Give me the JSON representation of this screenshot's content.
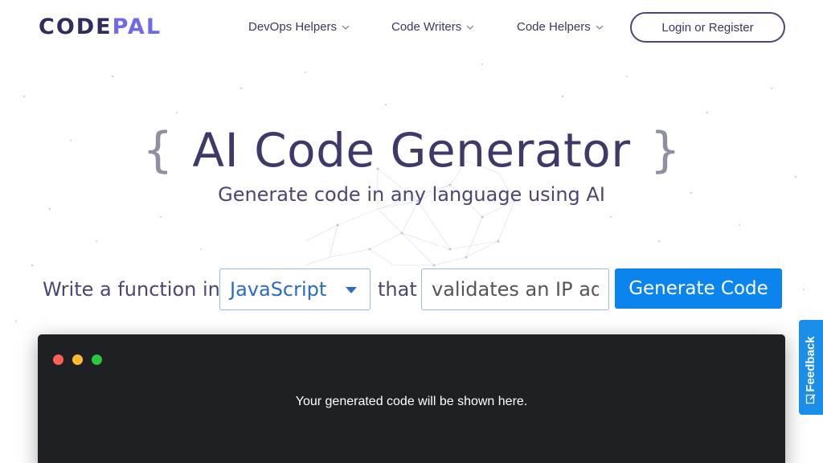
{
  "header": {
    "logo_primary": "CODE",
    "logo_accent": "PAL",
    "nav": [
      {
        "label": "DevOps Helpers"
      },
      {
        "label": "Code Writers"
      },
      {
        "label": "Code Helpers"
      }
    ],
    "login_label": "Login or Register"
  },
  "hero": {
    "brace_open": "{",
    "title": "AI Code Generator",
    "brace_close": "}",
    "subtitle": "Generate code in any language using AI"
  },
  "prompt": {
    "prefix": "Write a function in",
    "language": "JavaScript",
    "connector": "that",
    "task_placeholder": "validates an IP address",
    "button_label": "Generate Code"
  },
  "output": {
    "message": "Your generated code will be shown here."
  },
  "feedback": {
    "label": "Feedback"
  },
  "colors": {
    "brand_dark": "#2f2c5e",
    "brand_accent": "#6f6ae6",
    "primary_button": "#0b84ee",
    "output_bg": "#1f2024",
    "feedback_bg": "#1a8ee8"
  }
}
